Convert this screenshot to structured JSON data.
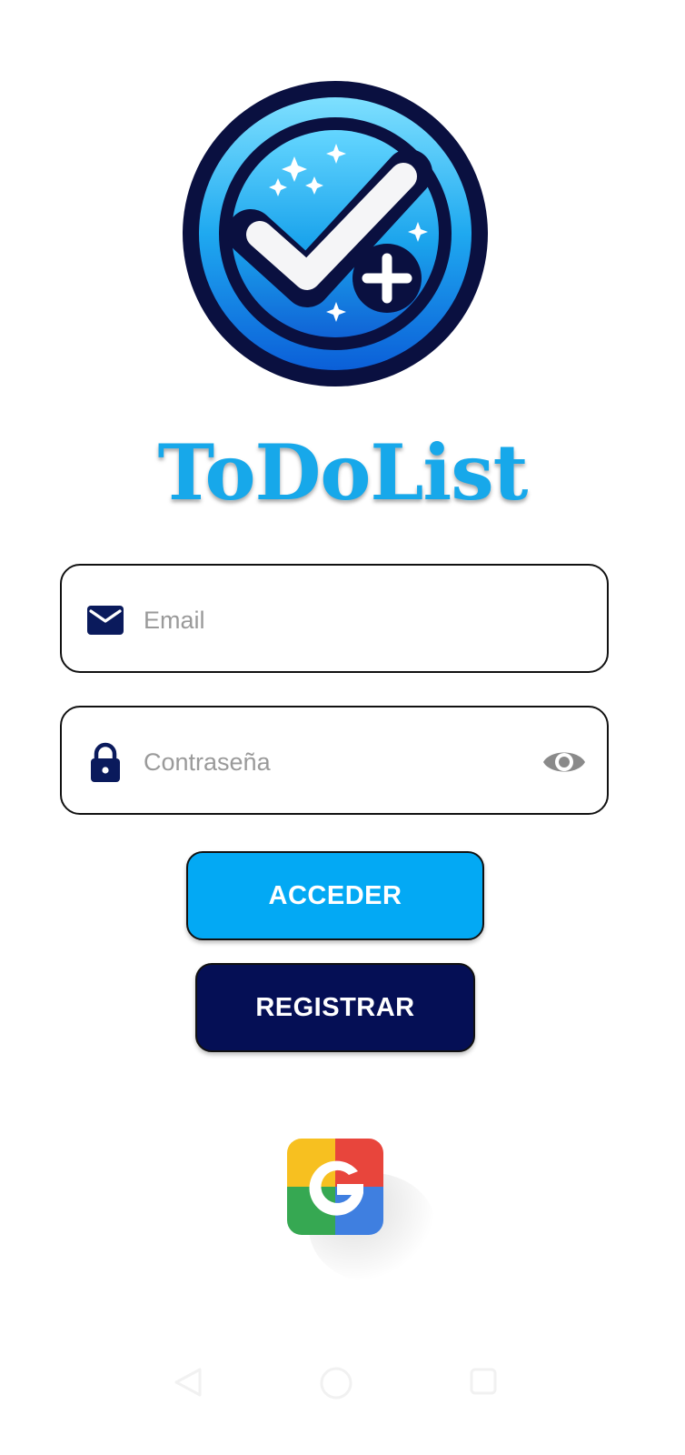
{
  "app": {
    "title": "ToDoList",
    "logo_icon": "checkmark-add-badge-icon"
  },
  "form": {
    "email": {
      "placeholder": "Email",
      "value": "",
      "icon": "envelope-icon"
    },
    "password": {
      "placeholder": "Contraseña",
      "value": "",
      "icon": "lock-icon",
      "toggle_icon": "eye-icon"
    }
  },
  "buttons": {
    "login_label": "ACCEDER",
    "register_label": "REGISTRAR",
    "google_icon": "google-icon"
  },
  "colors": {
    "title": "#17a8ea",
    "login_button": "#03a9f4",
    "register_button": "#050f55",
    "icon_navy": "#0a1a5c",
    "placeholder": "#9a9a9a"
  },
  "navbar": {
    "back_icon": "back-triangle-icon",
    "home_icon": "home-circle-icon",
    "recents_icon": "recents-square-icon"
  }
}
